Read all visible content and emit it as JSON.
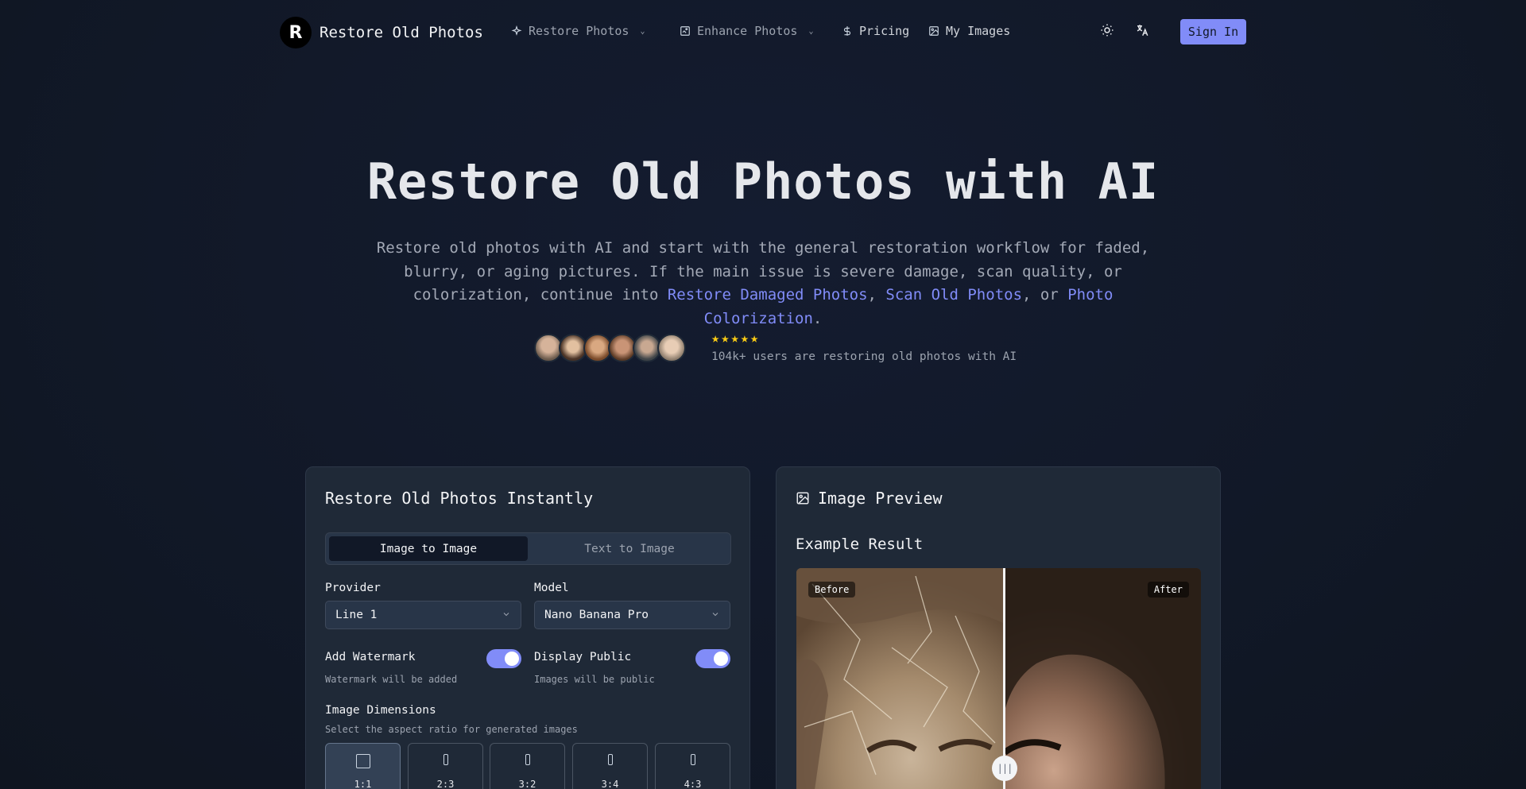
{
  "nav": {
    "brand_initial": "R",
    "brand_name": "Restore Old Photos",
    "items": [
      {
        "label": "Restore Photos",
        "icon": "sparkle-icon",
        "has_dropdown": true
      },
      {
        "label": "Enhance Photos",
        "icon": "image-enhance-icon",
        "has_dropdown": true
      },
      {
        "label": "Pricing",
        "icon": "dollar-icon",
        "has_dropdown": false
      },
      {
        "label": "My Images",
        "icon": "image-icon",
        "has_dropdown": false
      }
    ],
    "theme_icon": "sun-icon",
    "language_icon": "translate-icon",
    "sign_in": "Sign In"
  },
  "hero": {
    "title": "Restore Old Photos with AI",
    "desc_line1": "Restore old photos with AI and start with the general restoration workflow for faded,",
    "desc_line2": "blurry, or aging pictures. If the main issue is severe damage, scan quality, or",
    "desc_line3_prefix": "colorization, continue into ",
    "link1": "Restore Damaged Photos",
    "sep1": ", ",
    "link2": "Scan Old Photos",
    "sep2": ", or ",
    "link3": "Photo Colorization",
    "desc_end": ".",
    "rating_stars": 5,
    "social_proof": "104k+ users are restoring old photos with AI"
  },
  "generator": {
    "title": "Restore Old Photos Instantly",
    "tabs": [
      "Image to Image",
      "Text to Image"
    ],
    "active_tab": "Image to Image",
    "provider_label": "Provider",
    "provider_value": "Line 1",
    "model_label": "Model",
    "model_value": "Nano Banana Pro",
    "watermark_label": "Add Watermark",
    "watermark_hint": "Watermark will be added",
    "watermark_on": true,
    "public_label": "Display Public",
    "public_hint": "Images will be public",
    "public_on": true,
    "dimensions_label": "Image Dimensions",
    "dimensions_hint": "Select the aspect ratio for generated images",
    "ratios": [
      "1:1",
      "2:3",
      "3:2",
      "3:4",
      "4:3"
    ],
    "selected_ratio": "1:1"
  },
  "preview": {
    "title": "Image Preview",
    "subtitle": "Example Result",
    "before_label": "Before",
    "after_label": "After",
    "slider_position": 0.515
  },
  "colors": {
    "accent": "#818cf8",
    "background": "#111827",
    "card": "#1f2937",
    "star": "#facc15"
  }
}
